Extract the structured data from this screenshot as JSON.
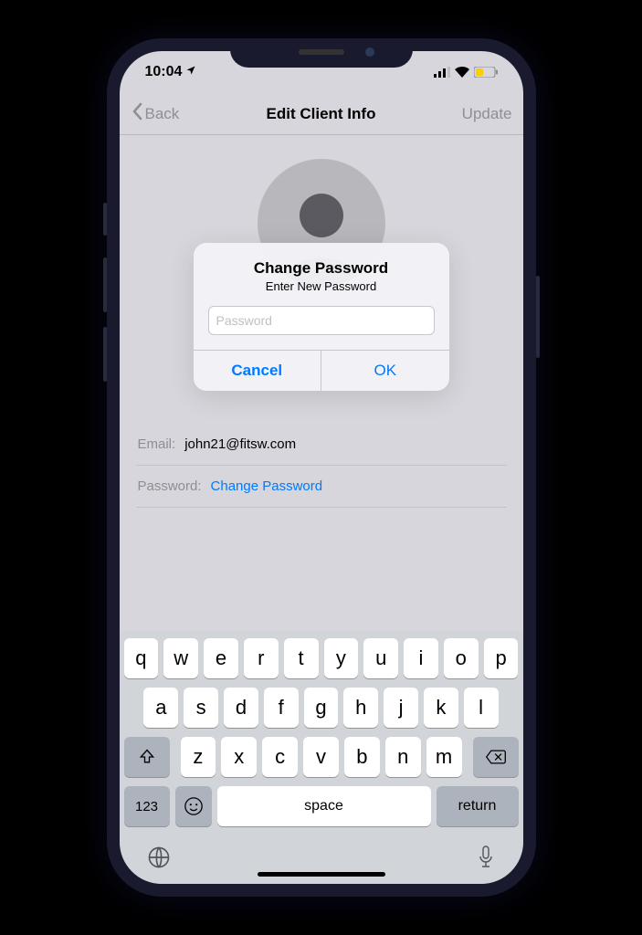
{
  "status": {
    "time": "10:04"
  },
  "nav": {
    "back": "Back",
    "title": "Edit Client Info",
    "update": "Update"
  },
  "fields": {
    "email_label": "Email:",
    "email_value": "john21@fitsw.com",
    "password_label": "Password:",
    "password_link": "Change Password"
  },
  "alert": {
    "title": "Change Password",
    "message": "Enter New Password",
    "placeholder": "Password",
    "cancel": "Cancel",
    "ok": "OK"
  },
  "keyboard": {
    "row1": [
      "q",
      "w",
      "e",
      "r",
      "t",
      "y",
      "u",
      "i",
      "o",
      "p"
    ],
    "row2": [
      "a",
      "s",
      "d",
      "f",
      "g",
      "h",
      "j",
      "k",
      "l"
    ],
    "row3": [
      "z",
      "x",
      "c",
      "v",
      "b",
      "n",
      "m"
    ],
    "numbers": "123",
    "space": "space",
    "return": "return"
  }
}
